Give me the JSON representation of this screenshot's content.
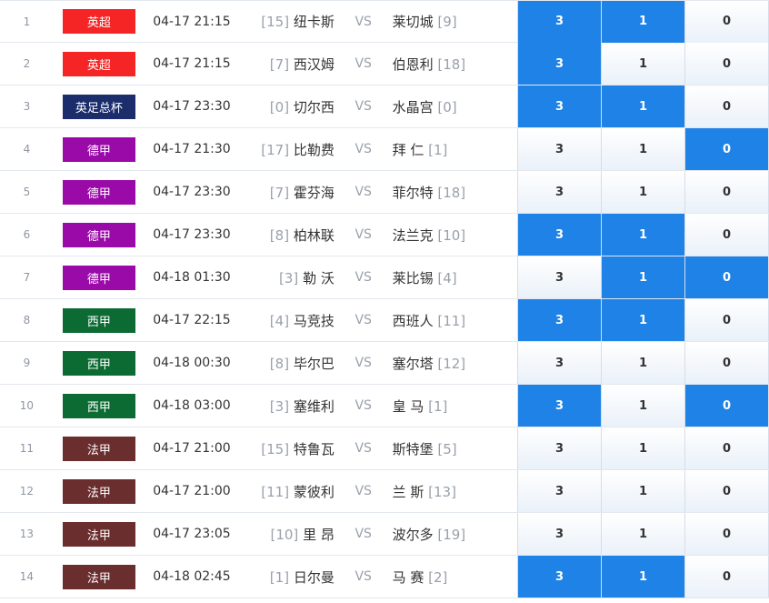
{
  "colors": {
    "selected": "#1e82e6",
    "英超": "#f52525",
    "英足总杯": "#1b2d6b",
    "德甲": "#9a0aa8",
    "西甲": "#0c6b33",
    "法甲": "#6b2e2e"
  },
  "rows": [
    {
      "idx": "1",
      "league": "英超",
      "time": "04-17 21:15",
      "home_rank": "[15]",
      "home": "纽卡斯",
      "vs": "VS",
      "away": "莱切城",
      "away_rank": "[9]",
      "opts": [
        "3",
        "1",
        "0"
      ],
      "sel": [
        true,
        true,
        false
      ]
    },
    {
      "idx": "2",
      "league": "英超",
      "time": "04-17 21:15",
      "home_rank": "[7]",
      "home": "西汉姆",
      "vs": "VS",
      "away": "伯恩利",
      "away_rank": "[18]",
      "opts": [
        "3",
        "1",
        "0"
      ],
      "sel": [
        true,
        false,
        false
      ]
    },
    {
      "idx": "3",
      "league": "英足总杯",
      "time": "04-17 23:30",
      "home_rank": "[0]",
      "home": "切尔西",
      "vs": "VS",
      "away": "水晶宫",
      "away_rank": "[0]",
      "opts": [
        "3",
        "1",
        "0"
      ],
      "sel": [
        true,
        true,
        false
      ]
    },
    {
      "idx": "4",
      "league": "德甲",
      "time": "04-17 21:30",
      "home_rank": "[17]",
      "home": "比勒费",
      "vs": "VS",
      "away": "拜 仁",
      "away_rank": "[1]",
      "opts": [
        "3",
        "1",
        "0"
      ],
      "sel": [
        false,
        false,
        true
      ]
    },
    {
      "idx": "5",
      "league": "德甲",
      "time": "04-17 23:30",
      "home_rank": "[7]",
      "home": "霍芬海",
      "vs": "VS",
      "away": "菲尔特",
      "away_rank": "[18]",
      "opts": [
        "3",
        "1",
        "0"
      ],
      "sel": [
        false,
        false,
        false
      ]
    },
    {
      "idx": "6",
      "league": "德甲",
      "time": "04-17 23:30",
      "home_rank": "[8]",
      "home": "柏林联",
      "vs": "VS",
      "away": "法兰克",
      "away_rank": "[10]",
      "opts": [
        "3",
        "1",
        "0"
      ],
      "sel": [
        true,
        true,
        false
      ]
    },
    {
      "idx": "7",
      "league": "德甲",
      "time": "04-18 01:30",
      "home_rank": "[3]",
      "home": "勒 沃",
      "vs": "VS",
      "away": "莱比锡",
      "away_rank": "[4]",
      "opts": [
        "3",
        "1",
        "0"
      ],
      "sel": [
        false,
        true,
        true
      ]
    },
    {
      "idx": "8",
      "league": "西甲",
      "time": "04-17 22:15",
      "home_rank": "[4]",
      "home": "马竞技",
      "vs": "VS",
      "away": "西班人",
      "away_rank": "[11]",
      "opts": [
        "3",
        "1",
        "0"
      ],
      "sel": [
        true,
        true,
        false
      ]
    },
    {
      "idx": "9",
      "league": "西甲",
      "time": "04-18 00:30",
      "home_rank": "[8]",
      "home": "毕尔巴",
      "vs": "VS",
      "away": "塞尔塔",
      "away_rank": "[12]",
      "opts": [
        "3",
        "1",
        "0"
      ],
      "sel": [
        false,
        false,
        false
      ]
    },
    {
      "idx": "10",
      "league": "西甲",
      "time": "04-18 03:00",
      "home_rank": "[3]",
      "home": "塞维利",
      "vs": "VS",
      "away": "皇 马",
      "away_rank": "[1]",
      "opts": [
        "3",
        "1",
        "0"
      ],
      "sel": [
        true,
        false,
        true
      ]
    },
    {
      "idx": "11",
      "league": "法甲",
      "time": "04-17 21:00",
      "home_rank": "[15]",
      "home": "特鲁瓦",
      "vs": "VS",
      "away": "斯特堡",
      "away_rank": "[5]",
      "opts": [
        "3",
        "1",
        "0"
      ],
      "sel": [
        false,
        false,
        false
      ]
    },
    {
      "idx": "12",
      "league": "法甲",
      "time": "04-17 21:00",
      "home_rank": "[11]",
      "home": "蒙彼利",
      "vs": "VS",
      "away": "兰 斯",
      "away_rank": "[13]",
      "opts": [
        "3",
        "1",
        "0"
      ],
      "sel": [
        false,
        false,
        false
      ]
    },
    {
      "idx": "13",
      "league": "法甲",
      "time": "04-17 23:05",
      "home_rank": "[10]",
      "home": "里 昂",
      "vs": "VS",
      "away": "波尔多",
      "away_rank": "[19]",
      "opts": [
        "3",
        "1",
        "0"
      ],
      "sel": [
        false,
        false,
        false
      ]
    },
    {
      "idx": "14",
      "league": "法甲",
      "time": "04-18 02:45",
      "home_rank": "[1]",
      "home": "日尔曼",
      "vs": "VS",
      "away": "马 赛",
      "away_rank": "[2]",
      "opts": [
        "3",
        "1",
        "0"
      ],
      "sel": [
        true,
        true,
        false
      ]
    }
  ]
}
